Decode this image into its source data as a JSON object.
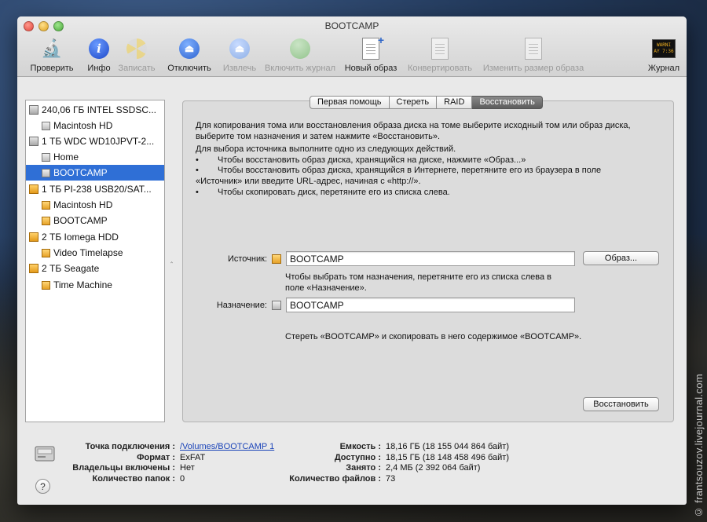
{
  "window": {
    "title": "BOOTCAMP"
  },
  "toolbar": {
    "items": [
      {
        "label": "Проверить",
        "icon": "microscope-icon",
        "enabled": true
      },
      {
        "label": "Инфо",
        "icon": "info-icon",
        "enabled": true
      },
      {
        "label": "Записать",
        "icon": "burn-icon",
        "enabled": false
      },
      {
        "label": "Отключить",
        "icon": "eject-icon",
        "enabled": true
      },
      {
        "label": "Извлечь",
        "icon": "unmount-icon",
        "enabled": false
      },
      {
        "label": "Включить журнал",
        "icon": "journal-globe-icon",
        "enabled": false
      },
      {
        "label": "Новый образ",
        "icon": "new-image-icon",
        "enabled": true
      },
      {
        "label": "Конвертировать",
        "icon": "convert-icon",
        "enabled": false
      },
      {
        "label": "Изменить размер образа",
        "icon": "resize-image-icon",
        "enabled": false
      },
      {
        "label": "Журнал",
        "icon": "log-icon",
        "enabled": true
      }
    ],
    "log_icon_text": "WARNI\nAY 7:36"
  },
  "sidebar": {
    "items": [
      {
        "label": "240,06 ГБ INTEL SSDSC...",
        "kind": "drive",
        "level": 0
      },
      {
        "label": "Macintosh HD",
        "kind": "volume",
        "level": 1
      },
      {
        "label": "1 ТБ WDC WD10JPVT-2...",
        "kind": "drive",
        "level": 0
      },
      {
        "label": "Home",
        "kind": "volume",
        "level": 1
      },
      {
        "label": "BOOTCAMP",
        "kind": "volume",
        "level": 1,
        "selected": true
      },
      {
        "label": "1 ТБ PI-238 USB20/SAT...",
        "kind": "ext-drive",
        "level": 0
      },
      {
        "label": "Macintosh HD",
        "kind": "ext-volume",
        "level": 1
      },
      {
        "label": "BOOTCAMP",
        "kind": "ext-volume",
        "level": 1
      },
      {
        "label": "2 ТБ Iomega HDD",
        "kind": "ext-drive",
        "level": 0
      },
      {
        "label": "Video Timelapse",
        "kind": "ext-volume",
        "level": 1
      },
      {
        "label": "2 ТБ Seagate",
        "kind": "ext-drive",
        "level": 0
      },
      {
        "label": "Time Machine",
        "kind": "ext-volume",
        "level": 1
      }
    ]
  },
  "tabs": [
    {
      "label": "Первая помощь",
      "active": false
    },
    {
      "label": "Стереть",
      "active": false
    },
    {
      "label": "RAID",
      "active": false
    },
    {
      "label": "Восстановить",
      "active": true
    }
  ],
  "restore": {
    "intro_line1": "Для копирования тома или восстановления образа диска на томе выберите исходный том или образ диска,",
    "intro_line2": "выберите том назначения и затем нажмите «Восстановить».",
    "source_heading": "Для выбора источника выполните одно из следующих действий.",
    "bullet_mark": "•",
    "bullet1": "Чтобы восстановить образ диска, хранящийся на диске, нажмите «Образ...»",
    "bullet2_line1": "Чтобы восстановить образ диска, хранящийся в Интернете, перетяните его из браузера в поле",
    "bullet2_line2": "«Источник» или введите URL-адрес, начиная с «http://».",
    "bullet3": "Чтобы скопировать диск, перетяните его из списка слева.",
    "source_label": "Источник:",
    "source_value": "BOOTCAMP",
    "image_button": "Образ...",
    "dest_hint_line1": "Чтобы выбрать том назначения, перетяните его из списка слева в",
    "dest_hint_line2": "поле «Назначение».",
    "dest_label": "Назначение:",
    "dest_value": "BOOTCAMP",
    "erase_note": "Стереть «BOOTCAMP» и скопировать в него содержимое «BOOTCAMP».",
    "restore_button": "Восстановить"
  },
  "info_left": [
    {
      "key": "Точка подключения :",
      "value": "/Volumes/BOOTCAMP 1",
      "link": true
    },
    {
      "key": "Формат :",
      "value": "ExFAT"
    },
    {
      "key": "Владельцы включены :",
      "value": "Нет"
    },
    {
      "key": "Количество папок :",
      "value": "0"
    }
  ],
  "info_right": [
    {
      "key": "Емкость :",
      "value": "18,16 ГБ (18 155 044 864 байт)"
    },
    {
      "key": "Доступно :",
      "value": "18,15 ГБ (18 148 458 496 байт)"
    },
    {
      "key": "Занято :",
      "value": "2,4 МБ (2 392 064 байт)"
    },
    {
      "key": "Количество файлов :",
      "value": "73"
    }
  ],
  "help_button": "?",
  "splitter_glyph": "‸",
  "watermark": "© frantsouzov.livejournal.com"
}
